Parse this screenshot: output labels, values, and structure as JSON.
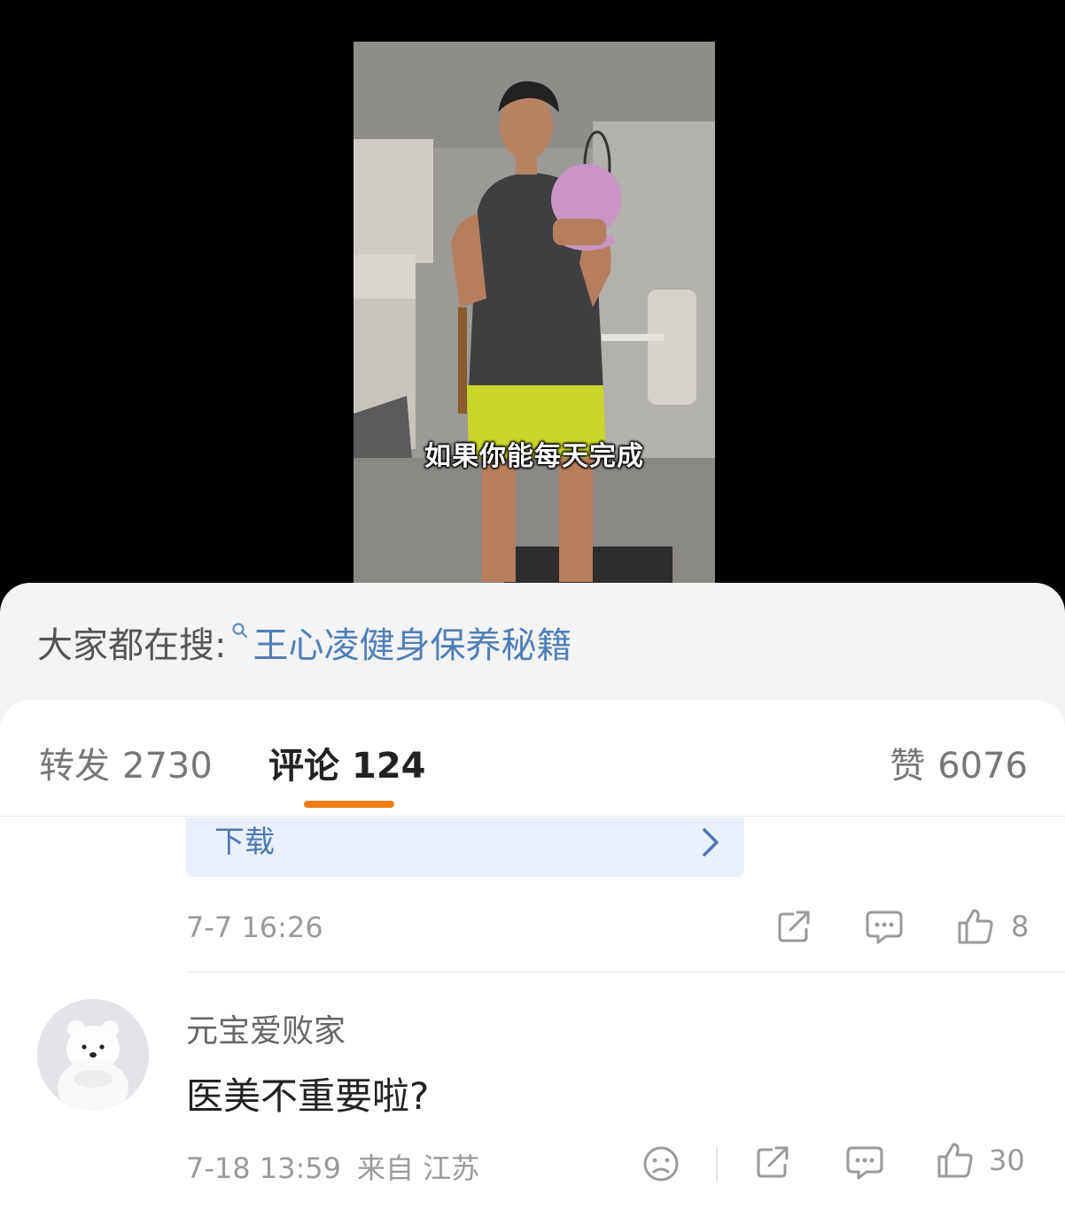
{
  "video": {
    "subtitle": "如果你能每天完成"
  },
  "search_hint": {
    "prefix": "大家都在搜:",
    "icon": "search-icon",
    "query": "王心凌健身保养秘籍"
  },
  "tabs": {
    "repost": {
      "label": "转发",
      "count": "2730"
    },
    "comments": {
      "label": "评论",
      "count": "124"
    },
    "likes": {
      "label": "赞",
      "count": "6076"
    },
    "active_color": "#f07d12"
  },
  "previous_comment": {
    "download_label": "下载",
    "timestamp": "7-7 16:26",
    "like_count": "8"
  },
  "comment": {
    "username": "元宝爱败家",
    "text": "医美不重要啦?",
    "timestamp": "7-18 13:59",
    "location": "来自 江苏",
    "like_count": "30"
  }
}
